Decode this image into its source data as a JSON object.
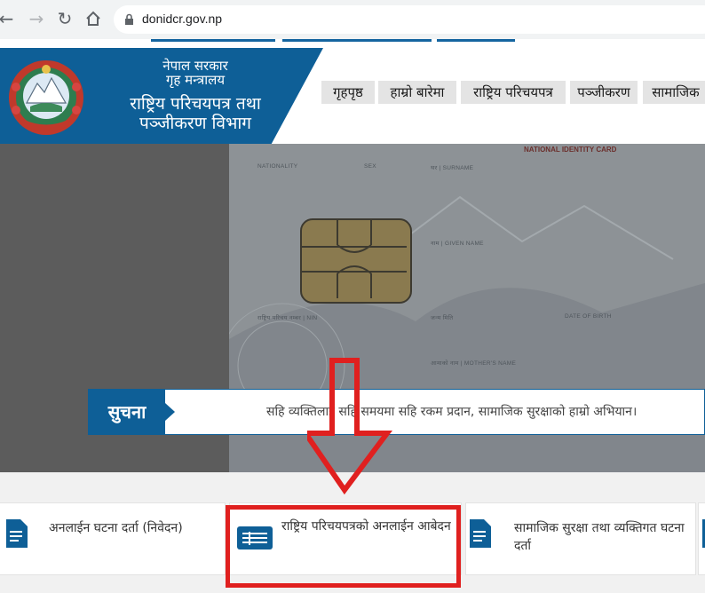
{
  "browser": {
    "url": "donidcr.gov.np"
  },
  "header": {
    "gov_line1": "नेपाल सरकार",
    "gov_line2": "गृह मन्त्रालय",
    "dept_line1": "राष्ट्रिय परिचयपत्र तथा",
    "dept_line2": "पञ्जीकरण विभाग",
    "menu": [
      "गृहपृष्ठ",
      "हाम्रो बारेमा",
      "राष्ट्रिय परिचयपत्र",
      "पञ्जीकरण",
      "सामाजिक"
    ]
  },
  "card": {
    "title": "NATIONAL IDENTITY CARD",
    "nationality": "NATIONALITY",
    "sex": "SEX",
    "surname": "थर | SURNAME",
    "given_name": "नाम | GIVEN NAME",
    "nin": "राष्ट्रिय परिचय नम्बर | NIN",
    "dob_np": "जन्म मिति",
    "dob": "DATE OF BIRTH",
    "mother": "आमाको नाम | MOTHER'S NAME"
  },
  "notice": {
    "label": "सुचना",
    "message": "सहि व्यक्तिलाई सहि समयमा सहि रकम प्रदान, सामाजिक सुरक्षाको हाम्रो अभियान।"
  },
  "tiles": {
    "t1": "अनलाईन घटना दर्ता (निवेदन)",
    "t2": "राष्ट्रिय परिचयपत्रको अनलाईन आबेदन",
    "t3_line1": "सामाजिक सुरक्षा तथा व्यक्तिगत घटना",
    "t3_line2": "दर्ता"
  },
  "colors": {
    "brand_blue": "#0e5f97",
    "annotation_red": "#e0201f"
  }
}
